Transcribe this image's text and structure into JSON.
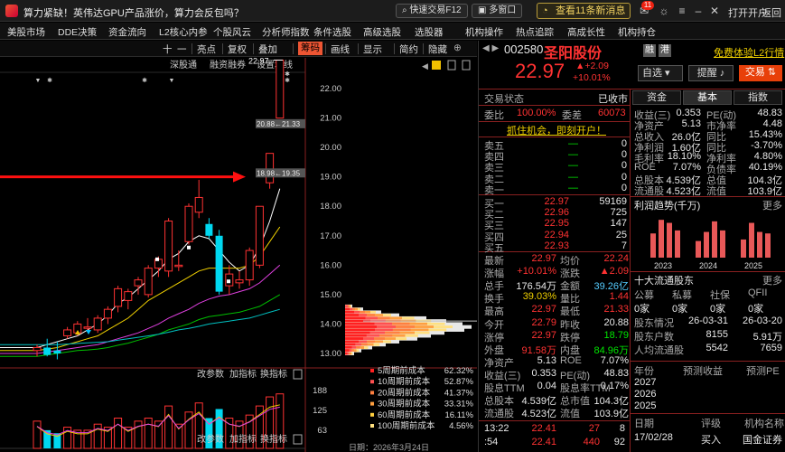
{
  "titlebar": {
    "news": "算力紧缺！英伟达GPU产品涨价，算力会反包吗？",
    "quick_trade": "快速交易F12",
    "multi_window": "多窗口",
    "notice": "查看11条新消息",
    "notice_count": "11",
    "open_account": "打开开户",
    "back": "返回"
  },
  "menubar": [
    "美股市场",
    "DDE决策",
    "资金流向",
    "L2核心内参",
    "个股风云",
    "分析师指数",
    "条件选股",
    "高级选股",
    "选股器",
    "机构操作",
    "热点追踪",
    "高成长性",
    "机构持仓"
  ],
  "chart_toolbar": {
    "items": [
      "十",
      "一",
      "亮点",
      "复权",
      "叠加",
      "筹码",
      "画线",
      "显示",
      "简约",
      "隐藏"
    ],
    "active": "筹码",
    "sub_items": [
      "深股通",
      "融资融券",
      "设置均线"
    ]
  },
  "chart_data": {
    "type": "candlestick",
    "y_ticks": [
      "22.00",
      "21.00",
      "20.00",
      "19.00",
      "18.00",
      "17.00",
      "16.00",
      "15.00",
      "14.00",
      "13.00"
    ],
    "ylim": [
      12.6,
      22.8
    ],
    "candles": [
      {
        "o": 13.1,
        "h": 13.3,
        "l": 12.9,
        "c": 13.2
      },
      {
        "o": 13.2,
        "h": 13.5,
        "l": 12.9,
        "c": 12.95
      },
      {
        "o": 13.1,
        "h": 13.4,
        "l": 12.8,
        "c": 13.0
      },
      {
        "o": 13.6,
        "h": 13.9,
        "l": 13.5,
        "c": 13.8
      },
      {
        "o": 13.7,
        "h": 14.1,
        "l": 13.6,
        "c": 14.0
      },
      {
        "o": 13.9,
        "h": 14.2,
        "l": 13.8,
        "c": 13.9
      },
      {
        "o": 13.8,
        "h": 14.3,
        "l": 13.7,
        "c": 14.2
      },
      {
        "o": 14.2,
        "h": 14.6,
        "l": 14.0,
        "c": 14.5
      },
      {
        "o": 14.6,
        "h": 15.3,
        "l": 14.4,
        "c": 15.2
      },
      {
        "o": 14.8,
        "h": 15.2,
        "l": 14.5,
        "c": 15.1
      },
      {
        "o": 15.3,
        "h": 15.6,
        "l": 15.0,
        "c": 15.5
      },
      {
        "o": 15.0,
        "h": 16.0,
        "l": 14.9,
        "c": 15.9
      },
      {
        "o": 15.9,
        "h": 16.3,
        "l": 15.6,
        "c": 16.2
      },
      {
        "o": 15.8,
        "h": 17.6,
        "l": 15.6,
        "c": 17.5
      },
      {
        "o": 16.0,
        "h": 16.5,
        "l": 15.8,
        "c": 16.0
      },
      {
        "o": 16.8,
        "h": 18.1,
        "l": 16.7,
        "c": 18.0
      },
      {
        "o": 17.8,
        "h": 18.9,
        "l": 17.6,
        "c": 18.3
      },
      {
        "o": 17.4,
        "h": 17.6,
        "l": 16.9,
        "c": 17.0
      },
      {
        "o": 17.0,
        "h": 17.2,
        "l": 15.0,
        "c": 15.1
      },
      {
        "o": 15.3,
        "h": 16.0,
        "l": 15.0,
        "c": 15.7
      },
      {
        "o": 15.4,
        "h": 15.8,
        "l": 15.2,
        "c": 15.5
      },
      {
        "o": 15.5,
        "h": 16.6,
        "l": 15.3,
        "c": 16.5
      },
      {
        "o": 16.0,
        "h": 18.0,
        "l": 15.9,
        "c": 18.0
      },
      {
        "o": 18.8,
        "h": 19.8,
        "l": 18.6,
        "c": 19.8
      },
      {
        "o": 21.0,
        "h": 22.97,
        "l": 21.0,
        "c": 22.97
      }
    ],
    "ma_lines": [
      {
        "color": "#ffffff",
        "values": [
          13.2,
          13.3,
          13.4,
          13.5,
          13.6,
          13.8,
          14.0,
          14.3,
          14.7,
          14.9,
          15.2,
          15.5,
          15.8,
          16.2,
          16.4,
          16.8,
          17.0,
          16.9,
          16.5,
          16.1,
          15.8,
          16.0,
          16.6,
          17.5,
          18.6
        ]
      },
      {
        "color": "#f0d000",
        "values": [
          13.1,
          13.15,
          13.2,
          13.3,
          13.4,
          13.5,
          13.6,
          13.8,
          14.0,
          14.2,
          14.5,
          14.8,
          15.0,
          15.2,
          15.4,
          15.6,
          15.8,
          15.9,
          15.9,
          15.9,
          15.9,
          16.0,
          16.3,
          16.8,
          17.3
        ]
      },
      {
        "color": "#e040e0",
        "values": [
          13.0,
          13.05,
          13.1,
          13.15,
          13.2,
          13.25,
          13.3,
          13.4,
          13.5,
          13.6,
          13.7,
          13.85,
          14.0,
          14.2,
          14.35,
          14.5,
          14.7,
          14.85,
          14.95,
          15.0,
          15.1,
          15.2,
          15.4,
          15.7,
          16.0
        ]
      },
      {
        "color": "#00c000",
        "values": [
          12.9,
          12.95,
          13.0,
          13.05,
          13.1,
          13.12,
          13.15,
          13.2,
          13.28,
          13.35,
          13.45,
          13.55,
          13.65,
          13.8,
          13.9,
          14.0,
          14.15,
          14.25,
          14.3,
          14.35,
          14.4,
          14.5,
          14.6,
          14.8,
          15.0
        ]
      },
      {
        "color": "#00c0c0",
        "values": [
          13.3,
          13.3,
          13.3,
          13.32,
          13.34,
          13.36,
          13.38,
          13.4,
          13.45,
          13.5,
          13.55,
          13.6,
          13.65,
          13.72,
          13.8,
          13.85,
          13.92,
          14.0,
          14.05,
          14.1,
          14.15,
          14.2,
          14.3,
          14.4,
          14.5
        ]
      }
    ],
    "annotations": {
      "high_label": "22.97",
      "label_mid1": "20.88←21.33",
      "label_mid2": "18.98←19.35"
    },
    "volume": [
      0.45,
      0.3,
      0.25,
      0.35,
      0.3,
      0.3,
      0.4,
      0.35,
      0.5,
      0.35,
      0.45,
      0.5,
      0.45,
      0.7,
      0.4,
      0.6,
      0.75,
      0.5,
      0.65,
      0.5,
      0.45,
      0.55,
      0.7,
      0.85,
      0.9
    ],
    "volume_ticks": [
      "188",
      "125",
      "63"
    ],
    "volume_labels": [
      "改参数",
      "加指标",
      "换指标"
    ],
    "chip_legend": [
      {
        "label": "5周期前成本",
        "value": "62.32%",
        "color": "#ff2020"
      },
      {
        "label": "10周期前成本",
        "value": "52.87%",
        "color": "#ff5050"
      },
      {
        "label": "20周期前成本",
        "value": "41.37%",
        "color": "#ff8040"
      },
      {
        "label": "30周期前成本",
        "value": "33.31%",
        "color": "#ffa040"
      },
      {
        "label": "60周期前成本",
        "value": "16.11%",
        "color": "#ffd040"
      },
      {
        "label": "100周期前成本",
        "value": "4.56%",
        "color": "#ffe080"
      }
    ],
    "chip_date": "日期：2026年3月24日"
  },
  "stock": {
    "code": "002580",
    "name": "圣阳股份",
    "tag1": "融",
    "tag2": "港",
    "free_l2": "免费体验L2行情",
    "price": "22.97",
    "change": "+2.09",
    "change_pct": "+10.01%",
    "self_select": "自选",
    "remind": "提醒",
    "trade": "交易"
  },
  "trade_status": {
    "label": "交易状态",
    "value": "已收市"
  },
  "weibi": {
    "label1": "委比",
    "value1": "100.00%",
    "label2": "委差",
    "value2": "60073"
  },
  "promo": "抓住机会，即刻开户！",
  "asks": [
    {
      "label": "卖五",
      "price": "—",
      "vol": "0"
    },
    {
      "label": "卖四",
      "price": "—",
      "vol": "0"
    },
    {
      "label": "卖三",
      "price": "—",
      "vol": "0"
    },
    {
      "label": "卖二",
      "price": "—",
      "vol": "0"
    },
    {
      "label": "卖一",
      "price": "—",
      "vol": "0"
    }
  ],
  "bids": [
    {
      "label": "买一",
      "price": "22.97",
      "vol": "59169"
    },
    {
      "label": "买二",
      "price": "22.96",
      "vol": "725"
    },
    {
      "label": "买三",
      "price": "22.95",
      "vol": "147"
    },
    {
      "label": "买四",
      "price": "22.94",
      "vol": "25"
    },
    {
      "label": "买五",
      "price": "22.93",
      "vol": "7"
    }
  ],
  "quote_stats": [
    {
      "l1": "最新",
      "v1": "22.97",
      "c1": "red",
      "l2": "均价",
      "v2": "22.24",
      "c2": "red"
    },
    {
      "l1": "涨幅",
      "v1": "+10.01%",
      "c1": "red",
      "l2": "涨跌",
      "v2": "▲2.09",
      "c2": "red"
    },
    {
      "l1": "总手",
      "v1": "176.54万",
      "c1": "white",
      "l2": "金额",
      "v2": "39.26亿",
      "c2": "cyan"
    },
    {
      "l1": "换手",
      "v1": "39.03%",
      "c1": "yellow",
      "l2": "量比",
      "v2": "1.44",
      "c2": "red"
    },
    {
      "l1": "最高",
      "v1": "22.97",
      "c1": "red",
      "l2": "最低",
      "v2": "21.33",
      "c2": "red"
    },
    {
      "l1": "今开",
      "v1": "22.79",
      "c1": "red",
      "l2": "昨收",
      "v2": "20.88",
      "c2": "white"
    },
    {
      "l1": "涨停",
      "v1": "22.97",
      "c1": "red",
      "l2": "跌停",
      "v2": "18.79",
      "c2": "green"
    },
    {
      "l1": "外盘",
      "v1": "91.58万",
      "c1": "red",
      "l2": "内盘",
      "v2": "84.96万",
      "c2": "green"
    },
    {
      "l1": "净资产",
      "v1": "5.13",
      "c1": "white",
      "l2": "ROE",
      "v2": "7.07%",
      "c2": "white"
    },
    {
      "l1": "收益(三)",
      "v1": "0.353",
      "c1": "white",
      "l2": "PE(动)",
      "v2": "48.83",
      "c2": "white"
    },
    {
      "l1": "股息TTM",
      "v1": "0.04",
      "c1": "white",
      "l2": "股息率TTM",
      "v2": "0.17%",
      "c2": "white"
    },
    {
      "l1": "总股本",
      "v1": "4.539亿",
      "c1": "white",
      "l2": "总市值",
      "v2": "104.3亿",
      "c2": "white"
    },
    {
      "l1": "流通股",
      "v1": "4.523亿",
      "c1": "white",
      "l2": "流值",
      "v2": "103.9亿",
      "c2": "white"
    }
  ],
  "ticks": [
    {
      "time": "13:22",
      "price": "22.41",
      "vol": "27",
      "flag": "8"
    },
    {
      "time": ":54",
      "price": "22.41",
      "vol": "440",
      "flag": "92"
    }
  ],
  "tabs": [
    "资金",
    "基本",
    "指数"
  ],
  "fund_rows": [
    {
      "l1": "收益(三)",
      "v1": "0.353",
      "l2": "PE(动)",
      "v2": "48.83"
    },
    {
      "l1": "净资产",
      "v1": "5.13",
      "l2": "市净率",
      "v2": "4.48"
    },
    {
      "l1": "总收入",
      "v1": "26.0亿",
      "l2": "同比",
      "v2": "15.43%"
    },
    {
      "l1": "净利润",
      "v1": "1.60亿",
      "l2": "同比",
      "v2": "-3.70%"
    },
    {
      "l1": "毛利率",
      "v1": "18.10%",
      "l2": "净利率",
      "v2": "4.80%"
    },
    {
      "l1": "ROE",
      "v1": "7.07%",
      "l2": "负债率",
      "v2": "40.19%"
    },
    {
      "l1": "总股本",
      "v1": "4.539亿",
      "l2": "总值",
      "v2": "104.3亿"
    },
    {
      "l1": "流通股",
      "v1": "4.523亿",
      "l2": "流值",
      "v2": "103.9亿"
    }
  ],
  "profit_trend": {
    "title": "利润趋势(千万)",
    "more": "更多",
    "years": [
      "2023",
      "2024",
      "2025"
    ],
    "bars": [
      3.2,
      5.0,
      4.6,
      3.6,
      2.2,
      3.4,
      4.8,
      3.6,
      2.4,
      4.6,
      3.4,
      3.2
    ]
  },
  "holders": {
    "title": "十大流通股东",
    "more": "更多",
    "cols": [
      "公募",
      "私募",
      "社保",
      "QFII"
    ],
    "vals": [
      "0家",
      "0家",
      "0家",
      "0家"
    ],
    "row2_label": "股东情况",
    "row2_v1": "26-03-31",
    "row2_v2": "26-03-20",
    "row3_label": "股东户数",
    "row3_v1": "8155",
    "row3_v2": "5.91万",
    "row4_label": "人均流通股",
    "row4_v1": "5542",
    "row4_v2": "7659"
  },
  "forecast": {
    "cols": [
      "年份",
      "预测收益",
      "预测PE"
    ],
    "years": [
      "2027",
      "2026",
      "2025"
    ]
  },
  "rating": {
    "cols": [
      "日期",
      "评级",
      "机构名称"
    ],
    "row": {
      "date": "17/02/28",
      "rating": "买入",
      "org": "国金证券"
    }
  }
}
